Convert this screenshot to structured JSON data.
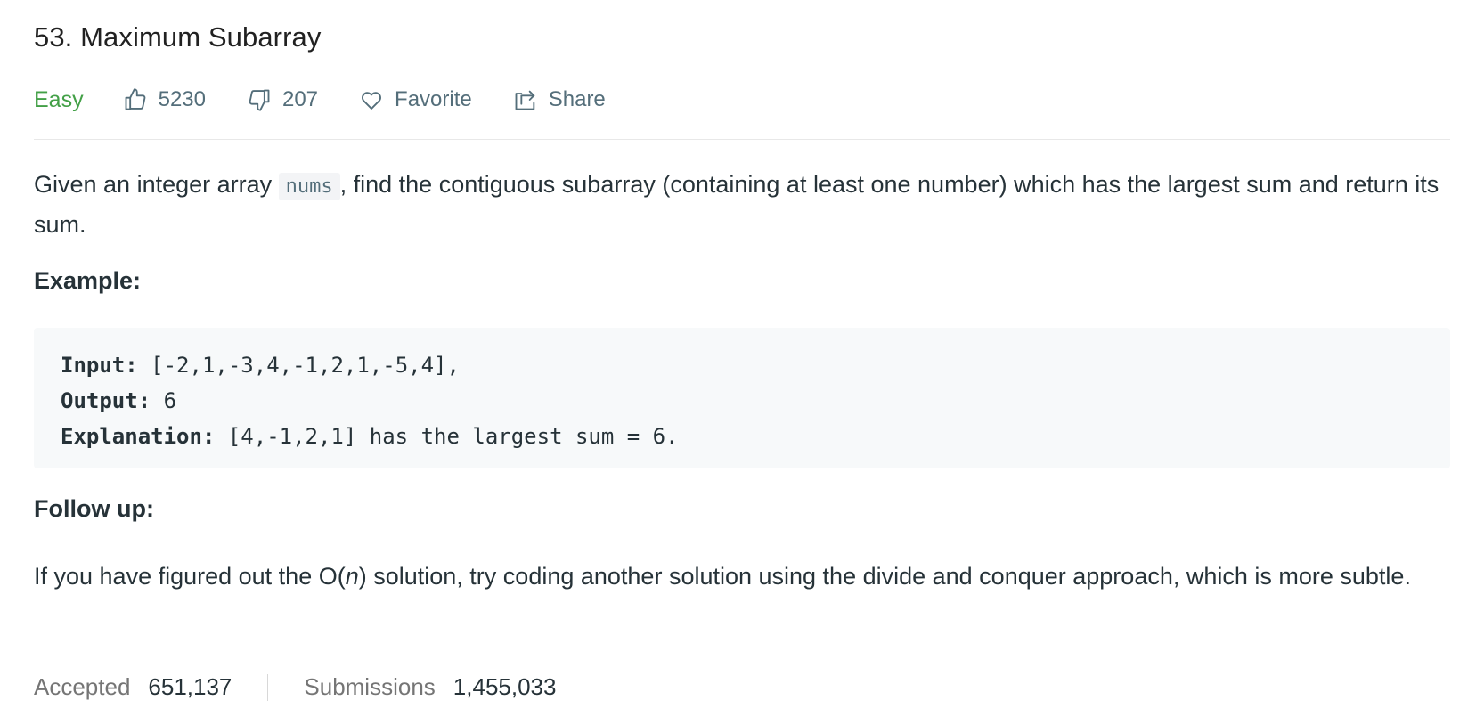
{
  "problem": {
    "title": "53. Maximum Subarray",
    "difficulty": "Easy",
    "likes": "5230",
    "dislikes": "207",
    "favorite_label": "Favorite",
    "share_label": "Share"
  },
  "description": {
    "before_code": "Given an integer array ",
    "code": "nums",
    "after_code": ", find the contiguous subarray (containing at least one number) which has the largest sum and return its sum."
  },
  "example": {
    "heading": "Example:",
    "input_label": "Input:",
    "input_value": " [-2,1,-3,4,-1,2,1,-5,4],",
    "output_label": "Output:",
    "output_value": " 6",
    "explanation_label": "Explanation:",
    "explanation_value": " [4,-1,2,1] has the largest sum = 6."
  },
  "follow_up": {
    "heading": "Follow up:",
    "text_before": "If you have figured out the O(",
    "text_italic": "n",
    "text_after": ") solution, try coding another solution using the divide and conquer approach, which is more subtle."
  },
  "stats": {
    "accepted_label": "Accepted",
    "accepted_value": "651,137",
    "submissions_label": "Submissions",
    "submissions_value": "1,455,033"
  },
  "colors": {
    "difficulty_easy": "#43a047",
    "text_primary": "#263238",
    "text_muted": "#546e7a"
  },
  "icons": [
    "thumbs-up-icon",
    "thumbs-down-icon",
    "heart-icon",
    "share-icon"
  ]
}
